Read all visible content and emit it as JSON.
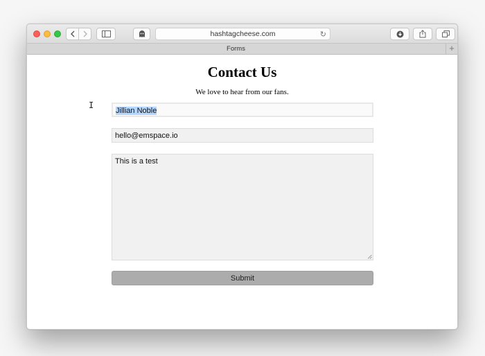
{
  "browser": {
    "address": "hashtagcheese.com",
    "tab_title": "Forms"
  },
  "page": {
    "title": "Contact Us",
    "subtitle": "We love to hear from our fans."
  },
  "form": {
    "name_value": "Jillian Noble",
    "email_value": "hello@emspace.io",
    "message_value": "This is a test",
    "submit_label": "Submit"
  },
  "icons": {
    "back": "chevron-left-icon",
    "forward": "chevron-right-icon",
    "sidebar": "sidebar-icon",
    "extension": "ghost-icon",
    "reload": "reload-icon",
    "download": "download-icon",
    "share": "share-icon",
    "tabs": "tabs-icon",
    "new_tab": "plus-icon"
  }
}
